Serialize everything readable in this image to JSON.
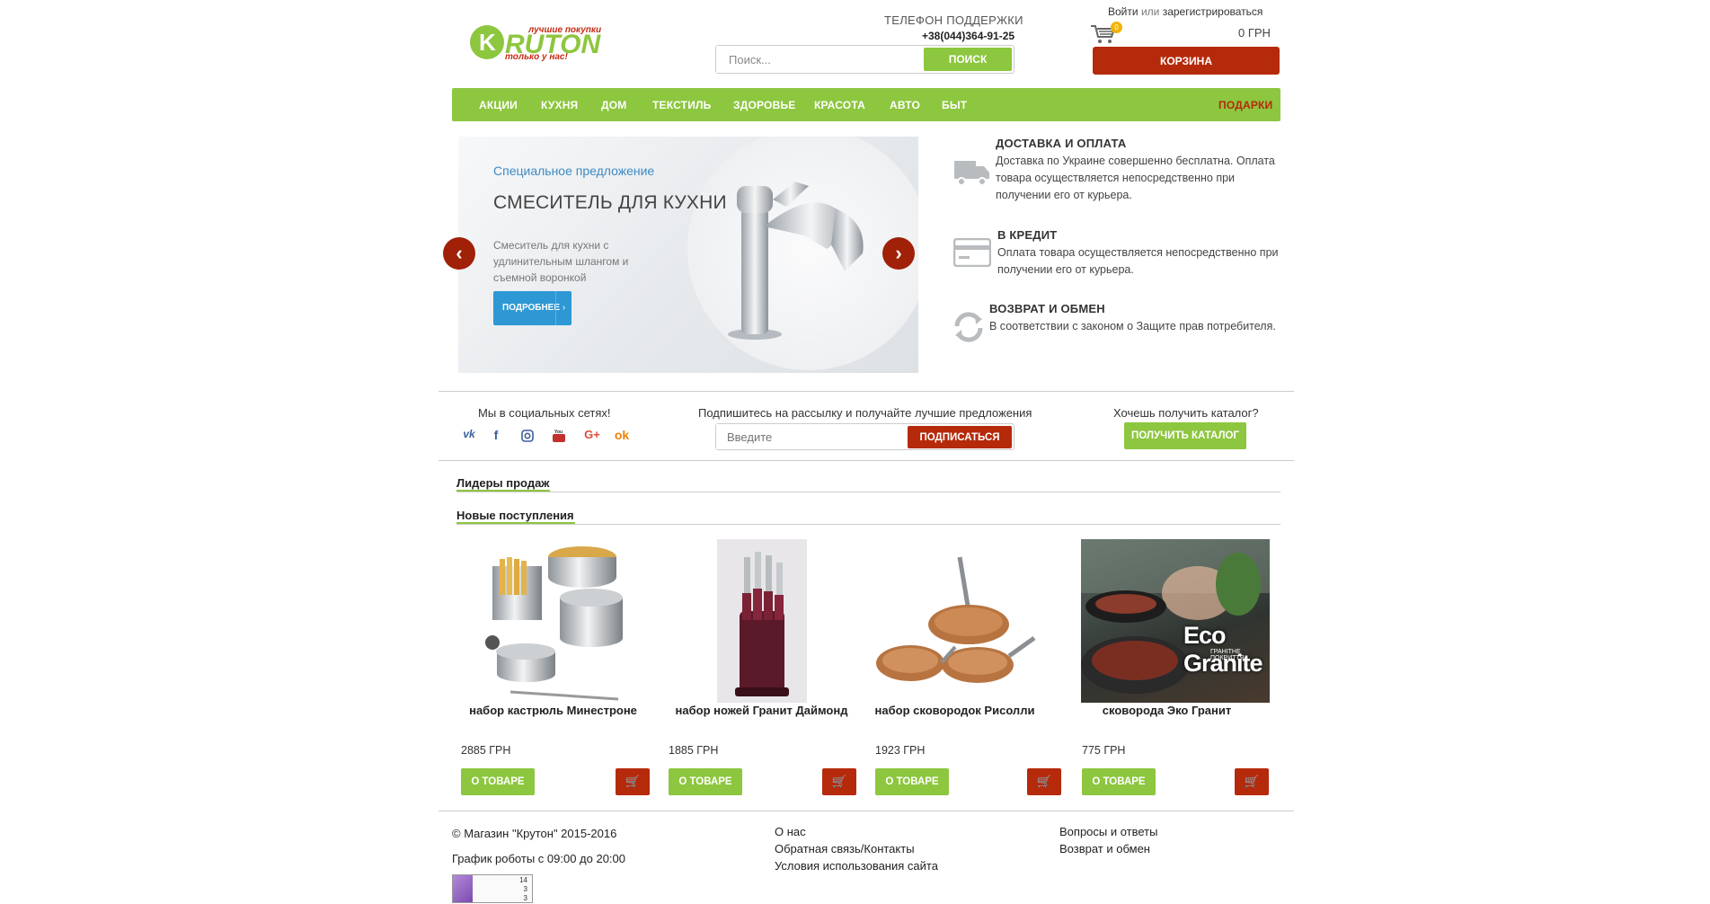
{
  "header": {
    "logo_text": "KRUTON",
    "logo_slogan_1": "лучшие покупки",
    "logo_slogan_2": "только у нас!",
    "support_label": "ТЕЛЕФОН ПОДДЕРЖКИ",
    "support_phone": "+38(044)364-91-25",
    "search_placeholder": "Поиск...",
    "search_button": "ПОИСК",
    "login_link": "Войти",
    "or_text": "или",
    "register_link": "зарегистрироваться",
    "cart_count": "0",
    "cart_sum": "0 ГРН",
    "cart_button": "КОРЗИНА"
  },
  "nav": {
    "items": [
      "АКЦИИ",
      "КУХНЯ",
      "ДОМ",
      "ТЕКСТИЛЬ",
      "ЗДОРОВЬЕ",
      "КРАСОТА",
      "АВТО",
      "БЫТ"
    ],
    "gift": "ПОДАРКИ"
  },
  "banner": {
    "subtitle": "Специальное предложение",
    "title": "СМЕСИТЕЛЬ ДЛЯ КУХНИ",
    "text": "Смеситель для кухни с удлинительным шлангом и съемной воронкой",
    "more_button": "ПОДРОБНЕЕ",
    "prev": "‹",
    "next": "›"
  },
  "features": [
    {
      "icon": "truck-icon",
      "title": "ДОСТАВКА И ОПЛАТА",
      "text": "Доставка по Украине совершенно бесплатна. Оплата товара осуществляется непосредственно при получении его от курьера."
    },
    {
      "icon": "credit-card-icon",
      "title": "В КРЕДИТ",
      "text": "Оплата товара осуществляется непосредственно при получении его от курьера."
    },
    {
      "icon": "refresh-icon",
      "title": "ВОЗВРАТ И ОБМЕН",
      "text": "В соответствии с законом о Защите прав потребителя."
    }
  ],
  "social": {
    "label": "Мы в социальных сетях!",
    "icons": [
      "vk-icon",
      "facebook-icon",
      "instagram-icon",
      "youtube-icon",
      "google-plus-icon",
      "odnoklassniki-icon"
    ]
  },
  "subscribe": {
    "label": "Подпишитесь на рассылку и получайте лучшие предложения",
    "placeholder": "Введите",
    "button": "ПОДПИСАТЬСЯ"
  },
  "catalog": {
    "label": "Хочешь получить каталог?",
    "button": "ПОЛУЧИТЬ КАТАЛОГ"
  },
  "sections": {
    "leaders": "Лидеры продаж",
    "new": "Новые поступления"
  },
  "products": [
    {
      "name": "набор кастрюль Минестроне",
      "price": "2885 ГРН",
      "button": "О ТОВАРЕ"
    },
    {
      "name": "набор ножей Гранит Даймонд",
      "price": "1885 ГРН",
      "button": "О ТОВАРЕ"
    },
    {
      "name": "набор сковородок Рисолли",
      "price": "1923 ГРН",
      "button": "О ТОВАРЕ"
    },
    {
      "name": "сковорода Эко Гранит",
      "price": "775 ГРН",
      "button": "О ТОВАРЕ",
      "image_text": "Eco Granite",
      "image_subtext": "ГРАНІТНЕ ПОКРИТТЯ"
    }
  ],
  "footer": {
    "copyright": "© Магазин \"Крутон\" 2015-2016",
    "schedule": "График роботы с 09:00 до 20:00",
    "col2": [
      "О нас",
      "Обратная связь/Контакты",
      "Условия использования сайта"
    ],
    "col3": [
      "Вопросы и ответы",
      "Возврат и обмен"
    ],
    "counter": [
      "14",
      "3",
      "3"
    ]
  },
  "colors": {
    "green": "#8dc63f",
    "red": "#b52a0b",
    "blue": "#2e98d4"
  }
}
